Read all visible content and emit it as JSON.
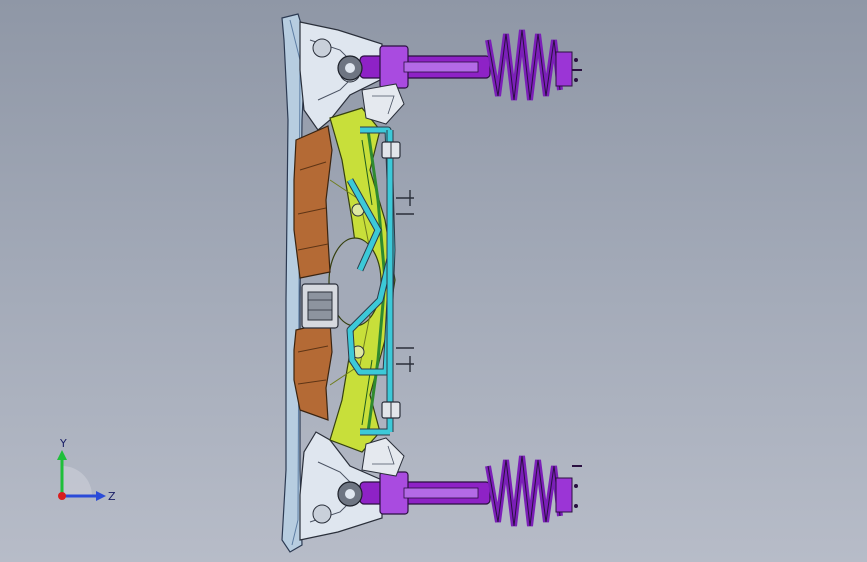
{
  "viewport": {
    "background_top": "#8f97a6",
    "background_bottom": "#b7bcc8"
  },
  "model": {
    "colors": {
      "strut": "#8e22c6",
      "spring": "#7b1fb8",
      "subframe_plate": "#b46a35",
      "crossmember": "#c8df3a",
      "stabilizer_bar": "#3cc9d8",
      "control_arm": "#dfe6ef",
      "frame_rail": "#b7cde0",
      "link_green": "#2f8a2f"
    }
  },
  "triad": {
    "y_label": "Y",
    "z_label": "Z",
    "y_color": "#1fbf3a",
    "z_color": "#2a4bd8",
    "origin_color": "#d81e1e"
  }
}
